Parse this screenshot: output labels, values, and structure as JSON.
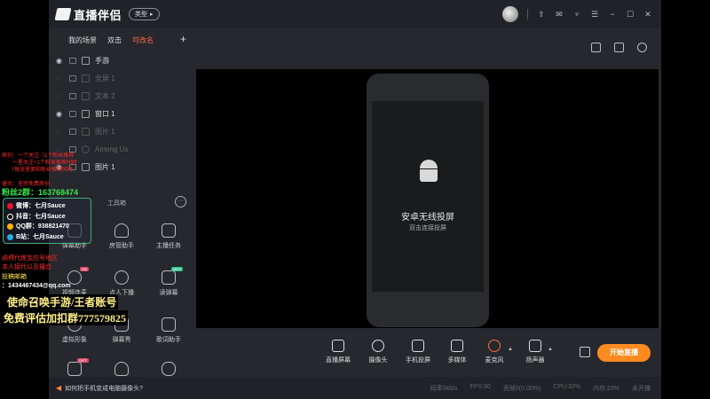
{
  "app": {
    "logo_text": "直播伴侣",
    "type_label": "类型",
    "type_caret": "▸"
  },
  "titlebar": {
    "icons": [
      "upload-icon",
      "mail-icon",
      "shirt-icon",
      "menu-icon",
      "minimize-icon",
      "maximize-icon",
      "close-icon"
    ]
  },
  "sidebar": {
    "tabs": [
      {
        "label": "我的场景",
        "active": false
      },
      {
        "label": "双击",
        "active": false
      },
      {
        "label": "可改名",
        "active": true
      }
    ],
    "add_label": "+",
    "sources": [
      {
        "name": "手游",
        "visible": true
      },
      {
        "name": "全屏 1",
        "visible": false
      },
      {
        "name": "文本 2",
        "visible": false
      },
      {
        "name": "窗口 1",
        "visible": true
      },
      {
        "name": "图片 1",
        "visible": false
      },
      {
        "name": "Among Us",
        "visible": false
      },
      {
        "name": "图片 1",
        "visible": true
      }
    ],
    "tools_title": "工具箱",
    "more_label": "···",
    "tools": [
      {
        "label": "弹幕助手"
      },
      {
        "label": "房管助手"
      },
      {
        "label": "主播任务"
      },
      {
        "label": "视频连麦",
        "badge": "ON"
      },
      {
        "label": "点人下播"
      },
      {
        "label": "读弹幕",
        "badge": "NEW"
      },
      {
        "label": "虚拟形象"
      },
      {
        "label": "弹幕秀"
      },
      {
        "label": "歌词助手"
      },
      {
        "label": "",
        "badge": "GIFT"
      },
      {
        "label": ""
      },
      {
        "label": ""
      }
    ]
  },
  "preview": {
    "phone_title": "安卓无线投屏",
    "phone_subtitle": "双击连接投屏"
  },
  "bottombar": {
    "items": [
      {
        "label": "直播屏幕"
      },
      {
        "label": "摄像头"
      },
      {
        "label": "手机投屏"
      },
      {
        "label": "多媒体"
      },
      {
        "label": "麦克风"
      },
      {
        "label": "扬声器"
      }
    ],
    "start_label": "开始直播"
  },
  "statusbar": {
    "tip_text": "如何把手机变成电脑摄像头?",
    "stats": [
      "码率0kb/s",
      "FPS:60",
      "丢帧0(0.00%)",
      "CPU:32%",
      "内存:23%",
      "未开播"
    ]
  },
  "overlay": {
    "red_lines": [
      "原创：一个关注（1个粉丝推荐",
      "一星关注+1个粉丝推荐同时",
      "（每张里面和粉丝推荐同时"
    ],
    "small_red": "留大：无穷免费原创",
    "group_line": "粉丝2群：163768474",
    "social": [
      {
        "text": "微博：七月Sauce"
      },
      {
        "text": "抖音：七月Sauce"
      },
      {
        "text": "QQ群：938821470"
      },
      {
        "text": "B站：七月Sauce"
      }
    ],
    "notice_1": "纳傅代练宝应号地区",
    "notice_2": "本人接代以及撮合",
    "email_label": "投稿邮箱",
    "email": "：1434467434@qq.com",
    "big_1": "使命召唤手游/王者账号",
    "big_2": "免费评估加扣群777579825"
  }
}
